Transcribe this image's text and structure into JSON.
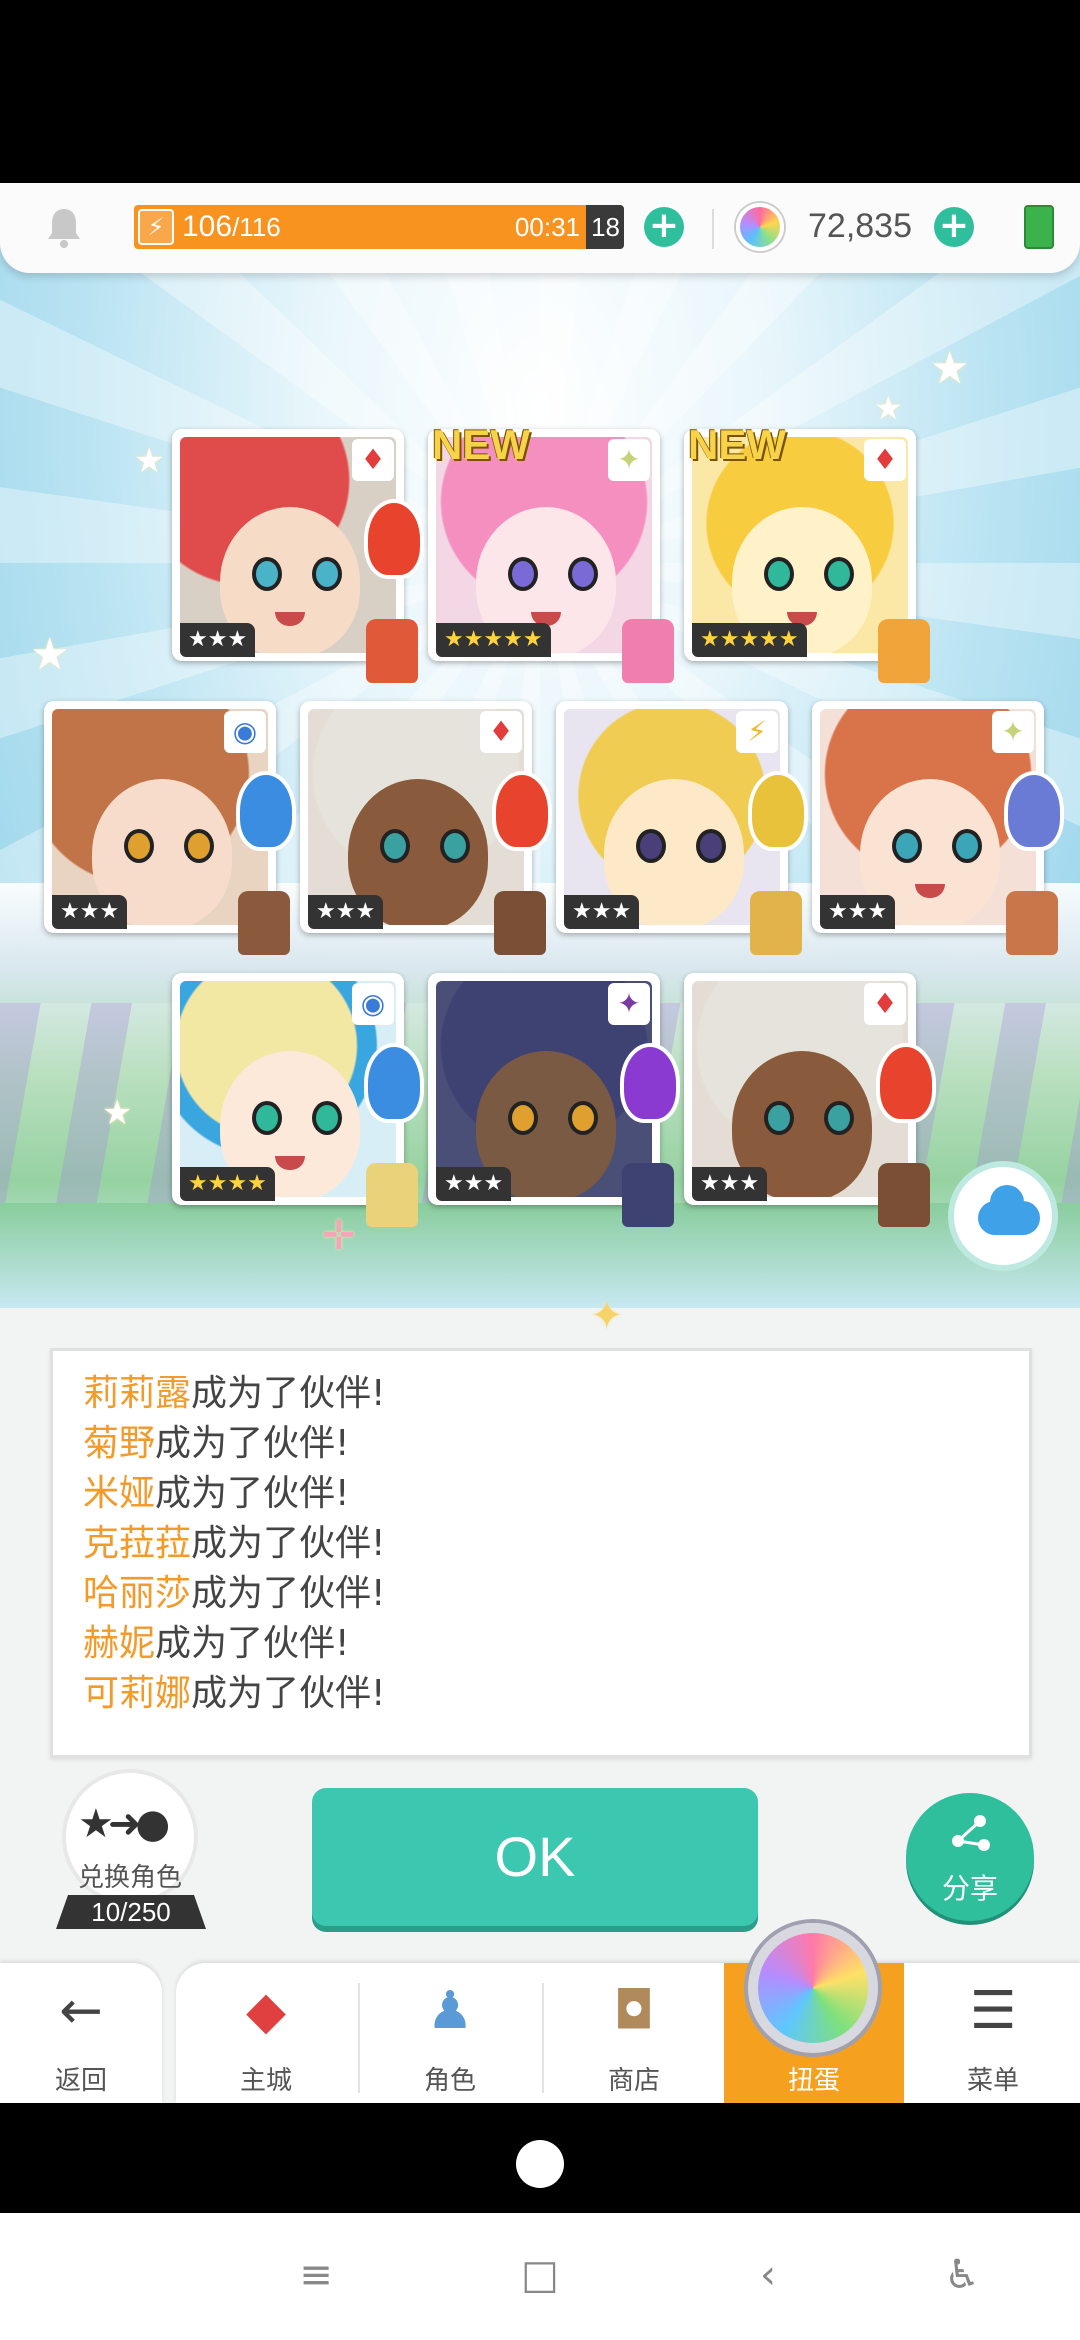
{
  "topbar": {
    "energy_current": "106",
    "energy_max": "/116",
    "energy_timer": "00:31",
    "energy_timer_sec": "18",
    "gems": "72,835"
  },
  "cards": [
    {
      "stars": "★★★",
      "element": "♦",
      "new": "",
      "stars_gold": false
    },
    {
      "stars": "★★★★★",
      "element": "✦",
      "new": "NEW",
      "stars_gold": true
    },
    {
      "stars": "★★★★★",
      "element": "♦",
      "new": "NEW",
      "stars_gold": true
    },
    {
      "stars": "★★★",
      "element": "◉",
      "new": "",
      "stars_gold": false
    },
    {
      "stars": "★★★",
      "element": "♦",
      "new": "",
      "stars_gold": false
    },
    {
      "stars": "★★★",
      "element": "⚡",
      "new": "",
      "stars_gold": false
    },
    {
      "stars": "★★★",
      "element": "✦",
      "new": "",
      "stars_gold": false
    },
    {
      "stars": "★★★★",
      "element": "◉",
      "new": "",
      "stars_gold": true
    },
    {
      "stars": "★★★",
      "element": "✦",
      "new": "",
      "stars_gold": false
    },
    {
      "stars": "★★★",
      "element": "♦",
      "new": "",
      "stars_gold": false
    }
  ],
  "messages": [
    {
      "name": "莉莉露",
      "suffix": "成为了伙伴!"
    },
    {
      "name": "菊野",
      "suffix": "成为了伙伴!"
    },
    {
      "name": "米娅",
      "suffix": "成为了伙伴!"
    },
    {
      "name": "克菈菈",
      "suffix": "成为了伙伴!"
    },
    {
      "name": "哈丽莎",
      "suffix": "成为了伙伴!"
    },
    {
      "name": "赫妮",
      "suffix": "成为了伙伴!"
    },
    {
      "name": "可莉娜",
      "suffix": "成为了伙伴!"
    }
  ],
  "actions": {
    "swap_label": "兑换角色",
    "swap_count": "10/250",
    "ok_label": "OK",
    "share_label": "分享"
  },
  "nav": {
    "back": "返回",
    "items": [
      "主城",
      "角色",
      "商店",
      "扭蛋",
      "菜单"
    ]
  },
  "colors": {
    "accent_teal": "#3cc8b0",
    "energy_orange": "#f7931e",
    "nav_active": "#f6a020",
    "name_orange": "#f29a2a"
  }
}
